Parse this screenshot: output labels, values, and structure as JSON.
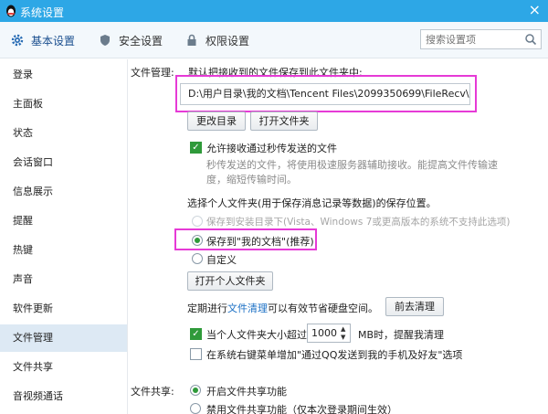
{
  "window": {
    "title": "系统设置",
    "close": "×"
  },
  "tabs": [
    {
      "label": "基本设置",
      "icon": "gear-icon"
    },
    {
      "label": "安全设置",
      "icon": "shield-icon"
    },
    {
      "label": "权限设置",
      "icon": "lock-icon"
    }
  ],
  "search": {
    "placeholder": "搜索设置项"
  },
  "sidebar": {
    "items": [
      {
        "label": "登录"
      },
      {
        "label": "主面板"
      },
      {
        "label": "状态"
      },
      {
        "label": "会话窗口"
      },
      {
        "label": "信息展示"
      },
      {
        "label": "提醒"
      },
      {
        "label": "热键"
      },
      {
        "label": "声音"
      },
      {
        "label": "软件更新"
      },
      {
        "label": "文件管理"
      },
      {
        "label": "文件共享"
      },
      {
        "label": "音视频通话"
      }
    ],
    "active": "文件管理"
  },
  "file_mgmt": {
    "section_label": "文件管理:",
    "save_desc": "默认把接收到的文件保存到此文件夹中:",
    "path": "D:\\用户目录\\我的文档\\Tencent Files\\2099350699\\FileRecv\\",
    "change_dir_btn": "更改目录",
    "open_folder_btn": "打开文件夹",
    "allow_instant_label": "允许接收通过秒传发送的文件",
    "instant_desc_line1": "秒传发送的文件，将使用极速服务器辅助接收。能提高文件传输速",
    "instant_desc_line2": "度，缩短传输时间。",
    "personal_folder_desc": "选择个人文件夹(用于保存消息记录等数据)的保存位置。",
    "opt_install_dir": "保存到安装目录下(Vista、Windows 7或更高版本的系统不支持此选项)",
    "opt_my_docs": "保存到\"我的文档\"(推荐)",
    "opt_custom": "自定义",
    "open_personal_btn": "打开个人文件夹",
    "cleanup_prefix": "定期进行",
    "cleanup_link": "文件清理",
    "cleanup_suffix": "可以有效节省硬盘空间。",
    "cleanup_btn": "前去清理",
    "size_prefix": "当个人文件夹大小超过",
    "size_value": "1000",
    "size_suffix": "MB时，提醒我清理",
    "context_menu_label": "在系统右键菜单增加\"通过QQ发送到我的手机及好友\"选项"
  },
  "file_share": {
    "section_label": "文件共享:",
    "opt_enable": "开启文件共享功能",
    "opt_disable": "禁用文件共享功能（仅本次登录期间生效）"
  },
  "colors": {
    "titlebar": "#2da7e6",
    "highlight": "#e63ad6",
    "check_green": "#2f9a3a",
    "link": "#1a6fc4"
  }
}
